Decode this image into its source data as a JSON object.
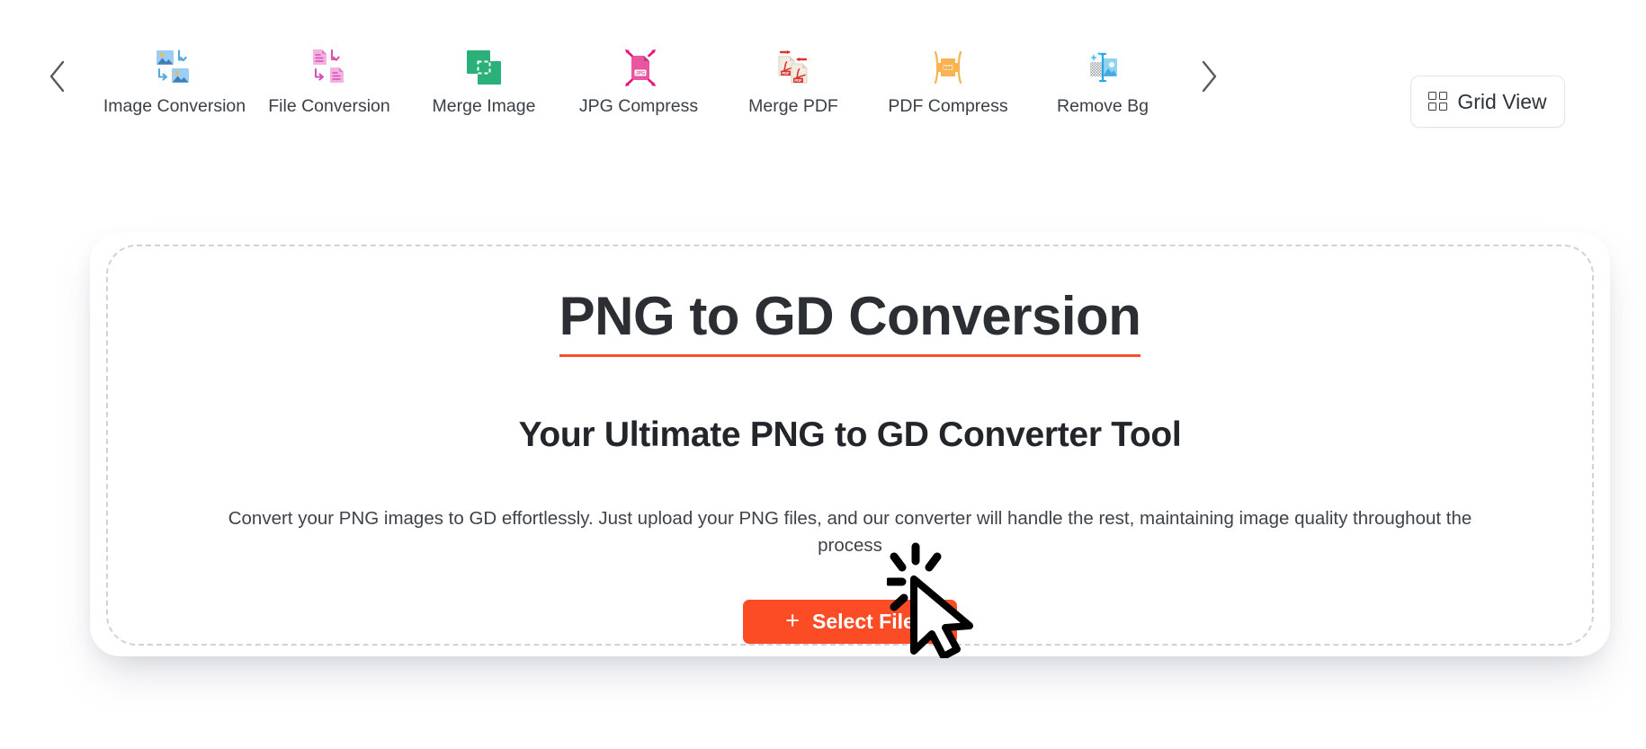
{
  "colors": {
    "accent": "#fb4c26",
    "title_underline": "#f4502a",
    "text_dark": "#2b2f34",
    "nav_label": "#3b4046",
    "dashed_border": "#cfd2d6",
    "card_bg": "#ffffff"
  },
  "toolbar": {
    "prev_arrow": "chevron-left-icon",
    "next_arrow": "chevron-right-icon",
    "grid_view": {
      "label": "Grid View",
      "icon": "grid-icon"
    },
    "tools": [
      {
        "label": "Image Conversion",
        "icon": "image-conversion-icon"
      },
      {
        "label": "File Conversion",
        "icon": "file-conversion-icon"
      },
      {
        "label": "Merge Image",
        "icon": "merge-image-icon"
      },
      {
        "label": "JPG Compress",
        "icon": "jpg-compress-icon"
      },
      {
        "label": "Merge PDF",
        "icon": "merge-pdf-icon"
      },
      {
        "label": "PDF Compress",
        "icon": "pdf-compress-icon"
      },
      {
        "label": "Remove Bg",
        "icon": "remove-bg-icon"
      }
    ]
  },
  "main": {
    "title": "PNG to GD Conversion",
    "subtitle": "Your Ultimate PNG to GD Converter Tool",
    "description": "Convert your PNG images to GD effortlessly. Just upload your PNG files, and our converter will handle the rest, maintaining image quality throughout the process",
    "select_file_label": "Select File",
    "select_file_plus": "+"
  },
  "cursor": {
    "icon": "mouse-pointer-click-icon"
  }
}
